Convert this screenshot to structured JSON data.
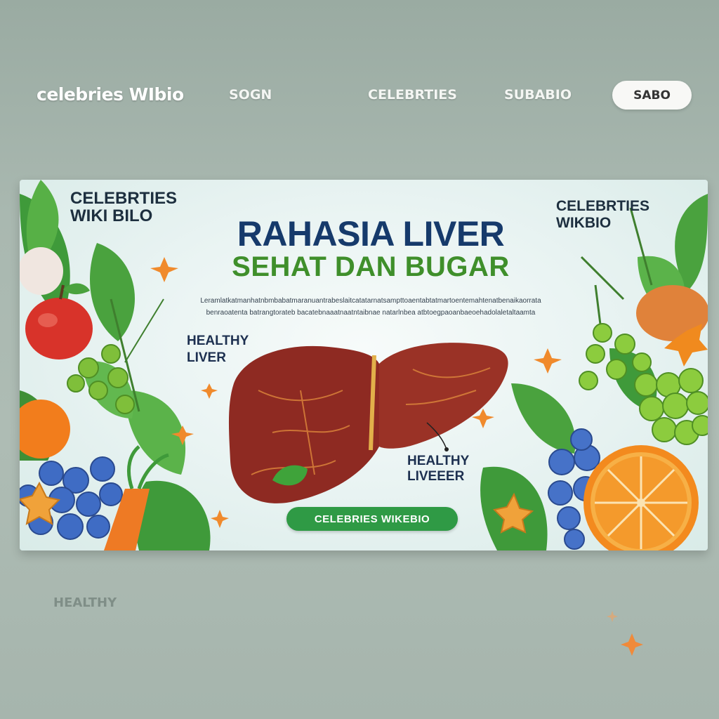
{
  "nav": {
    "brand": "celebries WIbio",
    "link_sign": "SOGN",
    "link_celebrities": "CELEBRTIES",
    "link_sub": "SUBABIO",
    "button": "SABO"
  },
  "banner": {
    "title": "RAHASIA LIVER",
    "subtitle": "SEHAT DAN BUGAR",
    "paragraph_line1": "Leramlatkatmanhatnbmbabatmaranuantrabeslaitcatatarnatsampttoaentabtatmartoentemahtenatbenaikaorrata",
    "paragraph_line2": "benraoatenta batrangtorateb bacatebnaaatnaatntaibnae natarlnbea atbtoegpaoanbaeoehadolaletaltaamta",
    "top_left_label_1": "CELEBRTIES",
    "top_left_label_2": "WIKI BILO",
    "top_right_label_1": "CELEBRTIES",
    "top_right_label_2": "WIKBIO",
    "healthy_left_1": "HEALTHY",
    "healthy_left_2": "LIVER",
    "healthy_right_1": "HEALTHY",
    "healthy_right_2": "LIVEEER",
    "pill_label": "CELEBRIES WIKEBIO"
  },
  "footer": {
    "healthy": "HEALTHY"
  },
  "colors": {
    "title": "#163a6b",
    "subtitle": "#3f8f2b",
    "pill": "#2f9a45",
    "liver": "#8e2a22",
    "background": "#a9b8b0"
  }
}
